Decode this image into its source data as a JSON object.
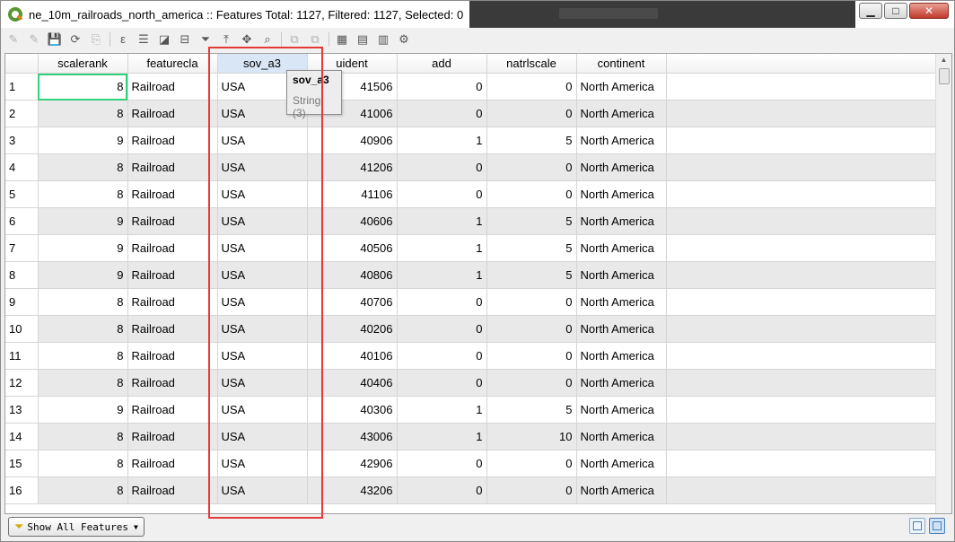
{
  "window": {
    "title": "ne_10m_railroads_north_america :: Features Total: 1127, Filtered: 1127, Selected: 0",
    "buttons": {
      "minimize": "▁",
      "maximize": "□",
      "close": "✕"
    }
  },
  "toolbar": {
    "icons": [
      {
        "name": "toggle-editing-icon",
        "glyph": "✎",
        "enabled": false
      },
      {
        "name": "multi-edit-icon",
        "glyph": "✎",
        "enabled": false
      },
      {
        "name": "save-edits-icon",
        "glyph": "💾",
        "enabled": false
      },
      {
        "name": "reload-icon",
        "glyph": "⟳",
        "enabled": true
      },
      {
        "name": "add-feature-icon",
        "glyph": "⎘",
        "enabled": false
      },
      {
        "name": "select-by-expression-icon",
        "glyph": "ε",
        "enabled": true
      },
      {
        "name": "select-all-icon",
        "glyph": "☰",
        "enabled": true
      },
      {
        "name": "invert-selection-icon",
        "glyph": "◪",
        "enabled": true
      },
      {
        "name": "deselect-all-icon",
        "glyph": "⊟",
        "enabled": true
      },
      {
        "name": "filter-select-icon",
        "glyph": "⏷",
        "enabled": true
      },
      {
        "name": "move-selection-top-icon",
        "glyph": "⤒",
        "enabled": true
      },
      {
        "name": "pan-to-selected-icon",
        "glyph": "✥",
        "enabled": true
      },
      {
        "name": "zoom-to-selected-icon",
        "glyph": "⌕",
        "enabled": true
      },
      {
        "name": "copy-cells-icon",
        "glyph": "⧉",
        "enabled": false
      },
      {
        "name": "paste-features-icon",
        "glyph": "⧉",
        "enabled": false
      },
      {
        "name": "delete-field-icon",
        "glyph": "▦",
        "enabled": true
      },
      {
        "name": "field-calculator-icon",
        "glyph": "▤",
        "enabled": true
      },
      {
        "name": "conditional-formatting-icon",
        "glyph": "▥",
        "enabled": true
      },
      {
        "name": "actions-icon",
        "glyph": "⚙",
        "enabled": true
      }
    ]
  },
  "table": {
    "columns": [
      "scalerank",
      "featurecla",
      "sov_a3",
      "uident",
      "add",
      "natrlscale",
      "continent"
    ],
    "rows": [
      {
        "n": "1",
        "c": [
          "8",
          "Railroad",
          "USA",
          "41506",
          "0",
          "0",
          "North America"
        ]
      },
      {
        "n": "2",
        "c": [
          "8",
          "Railroad",
          "USA",
          "41006",
          "0",
          "0",
          "North America"
        ]
      },
      {
        "n": "3",
        "c": [
          "9",
          "Railroad",
          "USA",
          "40906",
          "1",
          "5",
          "North America"
        ]
      },
      {
        "n": "4",
        "c": [
          "8",
          "Railroad",
          "USA",
          "41206",
          "0",
          "0",
          "North America"
        ]
      },
      {
        "n": "5",
        "c": [
          "8",
          "Railroad",
          "USA",
          "41106",
          "0",
          "0",
          "North America"
        ]
      },
      {
        "n": "6",
        "c": [
          "9",
          "Railroad",
          "USA",
          "40606",
          "1",
          "5",
          "North America"
        ]
      },
      {
        "n": "7",
        "c": [
          "9",
          "Railroad",
          "USA",
          "40506",
          "1",
          "5",
          "North America"
        ]
      },
      {
        "n": "8",
        "c": [
          "9",
          "Railroad",
          "USA",
          "40806",
          "1",
          "5",
          "North America"
        ]
      },
      {
        "n": "9",
        "c": [
          "8",
          "Railroad",
          "USA",
          "40706",
          "0",
          "0",
          "North America"
        ]
      },
      {
        "n": "10",
        "c": [
          "8",
          "Railroad",
          "USA",
          "40206",
          "0",
          "0",
          "North America"
        ]
      },
      {
        "n": "11",
        "c": [
          "8",
          "Railroad",
          "USA",
          "40106",
          "0",
          "0",
          "North America"
        ]
      },
      {
        "n": "12",
        "c": [
          "8",
          "Railroad",
          "USA",
          "40406",
          "0",
          "0",
          "North America"
        ]
      },
      {
        "n": "13",
        "c": [
          "9",
          "Railroad",
          "USA",
          "40306",
          "1",
          "5",
          "North America"
        ]
      },
      {
        "n": "14",
        "c": [
          "8",
          "Railroad",
          "USA",
          "43006",
          "1",
          "10",
          "North America"
        ]
      },
      {
        "n": "15",
        "c": [
          "8",
          "Railroad",
          "USA",
          "42906",
          "0",
          "0",
          "North America"
        ]
      },
      {
        "n": "16",
        "c": [
          "8",
          "Railroad",
          "USA",
          "43206",
          "0",
          "0",
          "North America"
        ]
      }
    ]
  },
  "tooltip": {
    "field": "sov_a3",
    "type": "String (3)"
  },
  "status": {
    "filter_label": "Show All Features"
  },
  "colors": {
    "current_cell": "#33d17a",
    "highlight_box": "#e53935"
  }
}
